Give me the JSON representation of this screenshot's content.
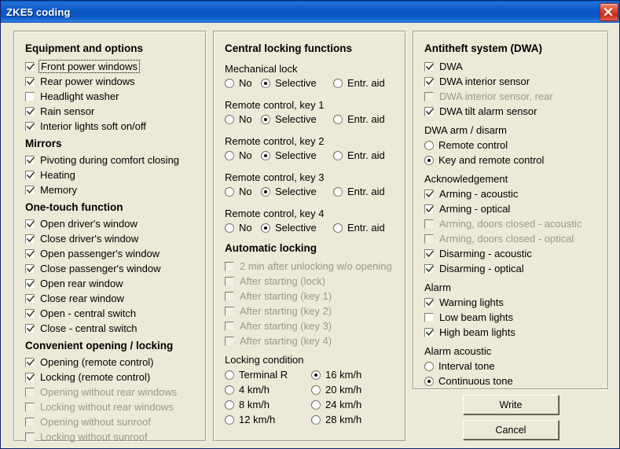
{
  "window": {
    "title": "ZKE5 coding",
    "close_icon": "close-icon",
    "accent_color": "#0a53c0",
    "face_color": "#ece9d8"
  },
  "panels": {
    "equipment": {
      "title": "Equipment and options",
      "items": [
        {
          "label": "Front power windows",
          "checked": true,
          "disabled": false,
          "focused": true
        },
        {
          "label": "Rear power windows",
          "checked": true,
          "disabled": false,
          "focused": false
        },
        {
          "label": "Headlight washer",
          "checked": false,
          "disabled": false,
          "focused": false
        },
        {
          "label": "Rain sensor",
          "checked": true,
          "disabled": false,
          "focused": false
        },
        {
          "label": "Interior lights soft on/off",
          "checked": true,
          "disabled": false,
          "focused": false
        }
      ],
      "mirrors_title": "Mirrors",
      "mirrors": [
        {
          "label": "Pivoting during comfort closing",
          "checked": true,
          "disabled": false
        },
        {
          "label": "Heating",
          "checked": true,
          "disabled": false
        },
        {
          "label": "Memory",
          "checked": true,
          "disabled": false
        }
      ],
      "onetouch_title": "One-touch function",
      "onetouch": [
        {
          "label": "Open driver's window",
          "checked": true,
          "disabled": false
        },
        {
          "label": "Close driver's window",
          "checked": true,
          "disabled": false
        },
        {
          "label": "Open passenger's window",
          "checked": true,
          "disabled": false
        },
        {
          "label": "Close passenger's window",
          "checked": true,
          "disabled": false
        },
        {
          "label": "Open rear window",
          "checked": true,
          "disabled": false
        },
        {
          "label": "Close rear window",
          "checked": true,
          "disabled": false
        },
        {
          "label": "Open - central switch",
          "checked": true,
          "disabled": false
        },
        {
          "label": "Close - central switch",
          "checked": true,
          "disabled": false
        }
      ],
      "convenient_title": "Convenient opening / locking",
      "convenient": [
        {
          "label": "Opening (remote control)",
          "checked": true,
          "disabled": false
        },
        {
          "label": "Locking (remote control)",
          "checked": true,
          "disabled": false
        },
        {
          "label": "Opening without rear windows",
          "checked": false,
          "disabled": true
        },
        {
          "label": "Locking without rear windows",
          "checked": false,
          "disabled": true
        },
        {
          "label": "Opening without sunroof",
          "checked": false,
          "disabled": true
        },
        {
          "label": "Locking without sunroof",
          "checked": false,
          "disabled": true
        }
      ]
    },
    "central_locking": {
      "title": "Central locking functions",
      "radio_options": [
        "No",
        "Selective",
        "Entr. aid"
      ],
      "groups": [
        {
          "label": "Mechanical lock",
          "selected": "Selective"
        },
        {
          "label": "Remote control, key 1",
          "selected": "Selective"
        },
        {
          "label": "Remote control, key 2",
          "selected": "Selective"
        },
        {
          "label": "Remote control, key 3",
          "selected": "Selective"
        },
        {
          "label": "Remote control, key 4",
          "selected": "Selective"
        }
      ],
      "automatic_title": "Automatic locking",
      "automatic": [
        {
          "label": "2 min after unlocking w/o opening",
          "checked": false,
          "disabled": true
        },
        {
          "label": "After starting (lock)",
          "checked": false,
          "disabled": true
        },
        {
          "label": "After starting (key 1)",
          "checked": false,
          "disabled": true
        },
        {
          "label": "After starting (key 2)",
          "checked": false,
          "disabled": true
        },
        {
          "label": "After starting (key 3)",
          "checked": false,
          "disabled": true
        },
        {
          "label": "After starting (key 4)",
          "checked": false,
          "disabled": true
        }
      ],
      "locking_condition_title": "Locking condition",
      "locking_condition": {
        "selected": "16 km/h",
        "col1": [
          "Terminal R",
          "4 km/h",
          "8 km/h",
          "12 km/h"
        ],
        "col2": [
          "16 km/h",
          "20 km/h",
          "24 km/h",
          "28 km/h"
        ]
      }
    },
    "antitheft": {
      "title": "Antitheft system (DWA)",
      "items": [
        {
          "label": "DWA",
          "checked": true,
          "disabled": false
        },
        {
          "label": "DWA interior sensor",
          "checked": true,
          "disabled": false
        },
        {
          "label": "DWA interior sensor, rear",
          "checked": false,
          "disabled": true
        },
        {
          "label": "DWA tilt alarm sensor",
          "checked": true,
          "disabled": false
        }
      ],
      "arm_title": "DWA arm / disarm",
      "arm_options": [
        "Remote control",
        "Key and remote control"
      ],
      "arm_selected": "Key and remote control",
      "ack_title": "Acknowledgement",
      "ack": [
        {
          "label": "Arming - acoustic",
          "checked": true,
          "disabled": false
        },
        {
          "label": "Arming - optical",
          "checked": true,
          "disabled": false
        },
        {
          "label": "Arming, doors closed - acoustic",
          "checked": false,
          "disabled": true
        },
        {
          "label": "Arming, doors closed - optical",
          "checked": false,
          "disabled": true
        },
        {
          "label": "Disarming - acoustic",
          "checked": true,
          "disabled": false
        },
        {
          "label": "Disarming - optical",
          "checked": true,
          "disabled": false
        }
      ],
      "alarm_title": "Alarm",
      "alarm": [
        {
          "label": "Warning lights",
          "checked": true,
          "disabled": false
        },
        {
          "label": "Low beam lights",
          "checked": false,
          "disabled": false
        },
        {
          "label": "High beam lights",
          "checked": true,
          "disabled": false
        }
      ],
      "acoustic_title": "Alarm acoustic",
      "acoustic_options": [
        "Interval tone",
        "Continuous tone"
      ],
      "acoustic_selected": "Continuous tone"
    }
  },
  "buttons": {
    "write": "Write",
    "cancel": "Cancel"
  }
}
